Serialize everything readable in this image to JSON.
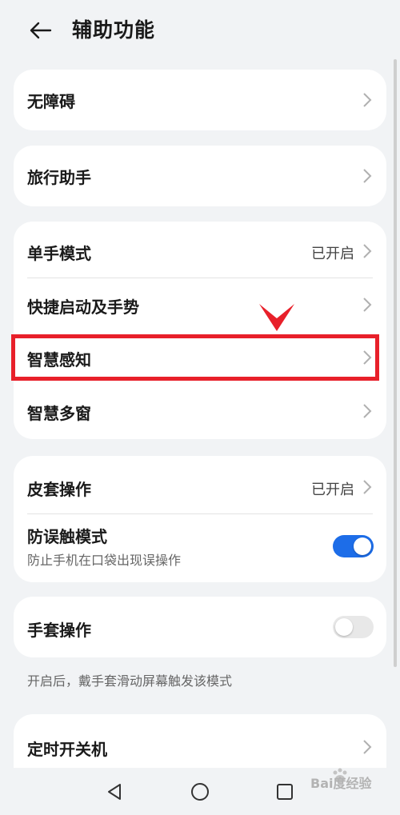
{
  "header": {
    "title": "辅助功能"
  },
  "groups": [
    {
      "items": [
        {
          "label": "无障碍"
        }
      ]
    },
    {
      "items": [
        {
          "label": "旅行助手"
        }
      ]
    },
    {
      "items": [
        {
          "label": "单手模式",
          "status": "已开启"
        },
        {
          "label": "快捷启动及手势"
        },
        {
          "label": "智慧感知"
        },
        {
          "label": "智慧多窗"
        }
      ]
    },
    {
      "items": [
        {
          "label": "皮套操作",
          "status": "已开启"
        },
        {
          "label": "防误触模式",
          "sub": "防止手机在口袋出现误操作",
          "toggle": true
        }
      ]
    },
    {
      "items": [
        {
          "label": "手套操作",
          "toggle": false
        }
      ],
      "note": "开启后，戴手套滑动屏幕触发该模式"
    },
    {
      "items": [
        {
          "label": "定时开关机"
        }
      ]
    }
  ],
  "colors": {
    "accent": "#1d6de8",
    "highlight": "#e8202a"
  },
  "watermark": "Bai度经验"
}
